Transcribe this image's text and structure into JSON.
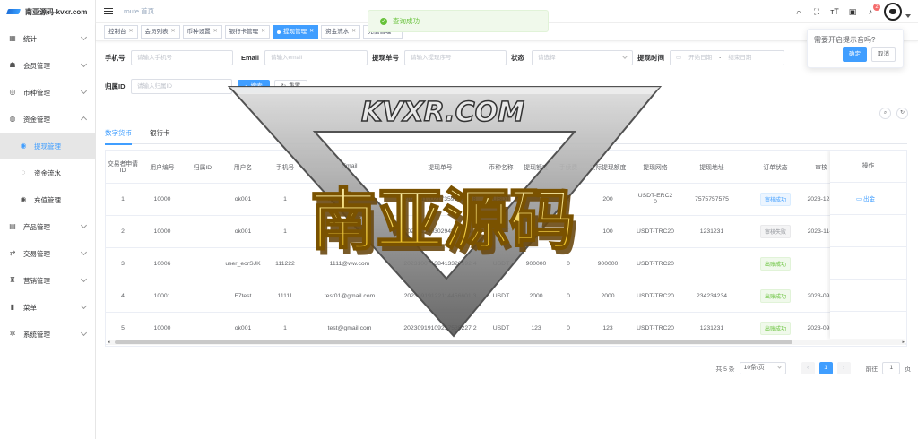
{
  "app": {
    "logo_text": "南亚源码-kvxr.com"
  },
  "sidebar": {
    "items": [
      {
        "label": "统计",
        "icon": "chart-icon"
      },
      {
        "label": "会员管理",
        "icon": "users-icon"
      },
      {
        "label": "币种管理",
        "icon": "coin-icon"
      },
      {
        "label": "资金管理",
        "icon": "wallet-icon"
      },
      {
        "label": "提现管理",
        "icon": "withdraw-icon"
      },
      {
        "label": "资金流水",
        "icon": "flow-icon"
      },
      {
        "label": "充值管理",
        "icon": "recharge-icon"
      },
      {
        "label": "产品管理",
        "icon": "product-icon"
      },
      {
        "label": "交易管理",
        "icon": "trade-icon"
      },
      {
        "label": "营销管理",
        "icon": "marketing-icon"
      },
      {
        "label": "菜单",
        "icon": "menu-icon"
      },
      {
        "label": "系统管理",
        "icon": "settings-icon"
      }
    ]
  },
  "header": {
    "breadcrumb": "route.首页",
    "notification_count": "2"
  },
  "tags": [
    {
      "label": "控制台"
    },
    {
      "label": "会员列表"
    },
    {
      "label": "币种设置"
    },
    {
      "label": "银行卡管理"
    },
    {
      "label": "提现管理"
    },
    {
      "label": "资金流水"
    },
    {
      "label": "充值管理"
    }
  ],
  "toast": {
    "message": "查询成功"
  },
  "popover": {
    "text": "需要开启提示音吗?",
    "confirm": "确定",
    "cancel": "取消"
  },
  "filters": {
    "phone": {
      "label": "手机号",
      "placeholder": "请输入手机号"
    },
    "email": {
      "label": "Email",
      "placeholder": "请输入email"
    },
    "order_no": {
      "label": "提现单号",
      "placeholder": "请输入提现序号"
    },
    "status": {
      "label": "状态",
      "placeholder": "请选择"
    },
    "time": {
      "label": "提现时间",
      "start": "开始日期",
      "sep": "-",
      "end": "结束日期"
    },
    "belong_id": {
      "label": "归属ID",
      "placeholder": "请输入归属ID"
    },
    "search_btn": "搜索",
    "reset_btn": "重置"
  },
  "tabs": [
    {
      "label": "数字货币"
    },
    {
      "label": "银行卡"
    }
  ],
  "table": {
    "columns": [
      "交易者申请ID",
      "用户编号",
      "归属ID",
      "用户名",
      "手机号",
      "Email",
      "提现单号",
      "币种名称",
      "提现额度",
      "手续费",
      "实际提现额度",
      "提现网络",
      "提现地址",
      "订单状态",
      "审核"
    ],
    "op_header": "操作",
    "op_label": "出金",
    "rows": [
      {
        "id": "1",
        "uid": "10000",
        "belong": "",
        "name": "ok001",
        "phone": "1",
        "email": "test@gmail.com",
        "order": "20231117021735913164 8",
        "coin": "USDT",
        "amount": "200",
        "fee": "0",
        "actual": "200",
        "network": "USDT-ERC20",
        "address": "7575757575",
        "status": "审核成功",
        "status_type": "review",
        "audit": "2023-12-0",
        "op": true
      },
      {
        "id": "2",
        "uid": "10000",
        "belong": "",
        "name": "ok001",
        "phone": "1",
        "email": "test@gmail.com",
        "order": "20231104030294827494 4",
        "coin": "USDT",
        "amount": "100",
        "fee": "0",
        "actual": "100",
        "network": "USDT-TRC20",
        "address": "1231231",
        "status": "审核失败",
        "status_type": "fail",
        "audit": "2023-11-0",
        "op": false
      },
      {
        "id": "3",
        "uid": "10006",
        "belong": "",
        "name": "user_eorSJK",
        "phone": "111222",
        "email": "1111@ww.com",
        "order": "20231007138413320592 4",
        "coin": "USDT",
        "amount": "900000",
        "fee": "0",
        "actual": "900000",
        "network": "USDT-TRC20",
        "address": "",
        "status": "出账成功",
        "status_type": "ok",
        "audit": "",
        "op": false
      },
      {
        "id": "4",
        "uid": "10001",
        "belong": "",
        "name": "F7test",
        "phone": "11111",
        "email": "test01@gmail.com",
        "order": "20230919122114456601 3",
        "coin": "USDT",
        "amount": "2000",
        "fee": "0",
        "actual": "2000",
        "network": "USDT-TRC20",
        "address": "234234234",
        "status": "出账成功",
        "status_type": "ok",
        "audit": "2023-09-2",
        "op": false
      },
      {
        "id": "5",
        "uid": "10000",
        "belong": "",
        "name": "ok001",
        "phone": "1",
        "email": "test@gmail.com",
        "order": "20230919109297535227 2",
        "coin": "USDT",
        "amount": "123",
        "fee": "0",
        "actual": "123",
        "network": "USDT-TRC20",
        "address": "1231231",
        "status": "出账成功",
        "status_type": "ok",
        "audit": "2023-09-1",
        "op": false
      }
    ]
  },
  "pagination": {
    "total": "共 5 条",
    "page_size": "10条/页",
    "current": "1",
    "goto": "前往",
    "goto_value": "1",
    "page_unit": "页"
  },
  "watermark": {
    "line1": "KVXR.COM",
    "line2": "南亚源码"
  },
  "colors": {
    "primary": "#409eff",
    "success": "#67c23a",
    "danger": "#f56c6c"
  }
}
